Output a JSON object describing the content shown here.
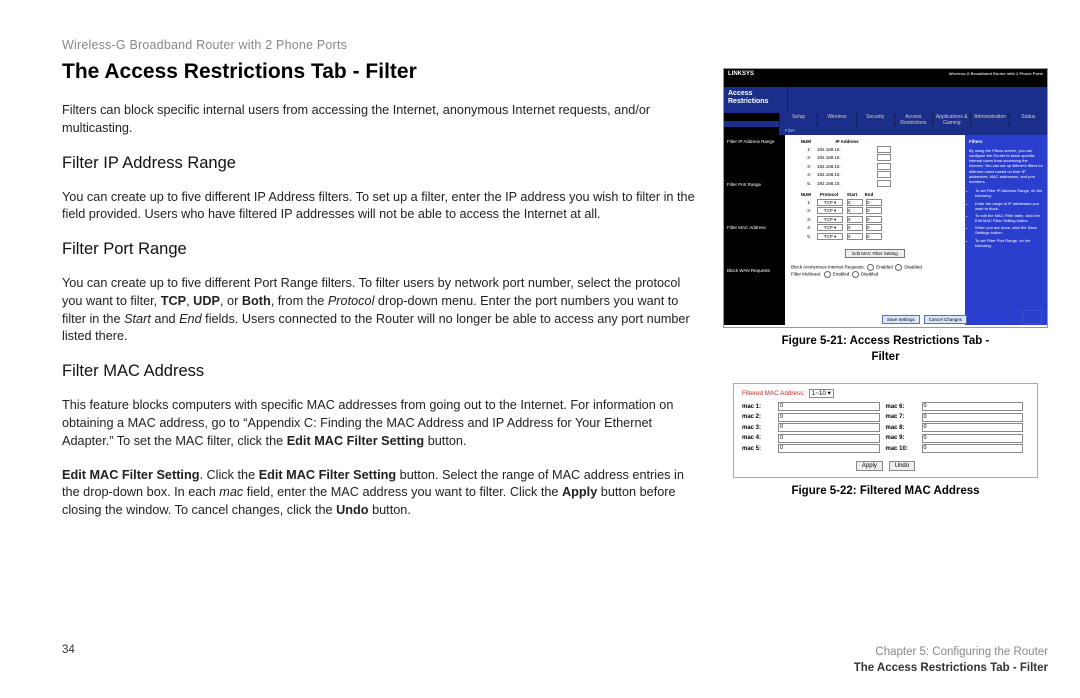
{
  "product_line": "Wireless-G Broadband Router with 2 Phone Ports",
  "heading": "The Access Restrictions Tab - Filter",
  "intro": "Filters can block specific internal users from accessing the Internet, anonymous Internet requests, and/or multicasting.",
  "sections": {
    "ip": {
      "title": "Filter IP Address Range",
      "body": "You can create up to five different IP Address filters. To set up a filter, enter the IP address you wish to filter in the field provided. Users who have filtered IP addresses will not be able to access the Internet at all."
    },
    "port": {
      "title": "Filter Port Range",
      "body_html": "You can create up to five different Port Range filters. To filter users by network port number, select the protocol you want to filter, <b>TCP</b>, <b>UDP</b>, or <b>Both</b>, from the <i>Protocol</i> drop-down menu. Enter the port numbers you want to filter in the <i>Start</i> and <i>End</i> fields. Users connected to the Router will no longer be able to access any port number listed there."
    },
    "mac": {
      "title": "Filter MAC Address",
      "body1_html": "This feature blocks computers with specific MAC addresses from going out to the Internet. For information on obtaining a MAC address, go to “Appendix C: Finding the MAC Address and IP Address for Your Ethernet Adapter.” To set the MAC filter, click the <b>Edit MAC Filter Setting</b> button.",
      "body2_html": "<b>Edit MAC Filter Setting</b>. Click the <b>Edit MAC Filter Setting</b> button. Select the range of MAC address entries in the drop-down box. In each <i>mac</i> field, enter the MAC address you want to filter.  Click the <b>Apply</b> button before closing the window. To cancel changes, click the <b>Undo</b> button."
    }
  },
  "fig1": {
    "caption": "Figure 5-21: Access Restrictions Tab - Filter",
    "brand": "LINKSYS",
    "device": "Wireless-G Broadband Router with 2 Phone Ports",
    "section": "Access Restrictions",
    "tabs": [
      "Setup",
      "Wireless",
      "Security",
      "Access Restrictions",
      "Applications & Gaming",
      "Administration",
      "Status"
    ],
    "subtabs": [
      "Filter"
    ],
    "left_labels": [
      "Filter IP Address Range",
      "Filter Port Range",
      "Filter MAC Address",
      "Block WAN Requests"
    ],
    "mid": {
      "ip_header_num": "NUM",
      "ip_header_addr": "IP Address",
      "ip_rows": [
        {
          "n": "1:",
          "ip": "192.168.15."
        },
        {
          "n": "2:",
          "ip": "192.168.15."
        },
        {
          "n": "3:",
          "ip": "192.168.15."
        },
        {
          "n": "4:",
          "ip": "192.168.15."
        },
        {
          "n": "5:",
          "ip": "192.168.15."
        }
      ],
      "port_headers": [
        "NUM",
        "Protocol",
        "Start",
        "End"
      ],
      "port_rows": [
        {
          "n": "1:",
          "proto": "TCP",
          "start": "0",
          "end": "0"
        },
        {
          "n": "2:",
          "proto": "TCP",
          "start": "0",
          "end": "0"
        },
        {
          "n": "3:",
          "proto": "TCP",
          "start": "0",
          "end": "0"
        },
        {
          "n": "4:",
          "proto": "TCP",
          "start": "0",
          "end": "0"
        },
        {
          "n": "5:",
          "proto": "TCP",
          "start": "0",
          "end": "0"
        }
      ],
      "mac_button": "Edit MAC Filter Setting",
      "wan_label": "Block Anonymous Internet Requests:",
      "wan_enabled": "Enabled",
      "wan_disabled": "Disabled",
      "multicast_label": "Filter Multicast:",
      "save": "Save Settings",
      "cancel": "Cancel Changes"
    },
    "help": {
      "title": "Filters",
      "intro": "By using the Filters screen, you can configure the Router to block specific internal users from accessing the Internet. You can set up different filters for different users based on their IP addresses, MAC addresses, and port numbers.",
      "items": [
        "To set Filter IP Address Range, do the following:",
        "Enter the range of IP addresses you want to block.",
        "To edit the MAC Filter table, click the Edit MAC Filter Setting button.",
        "When you are done, click the Save Settings button.",
        "To set Filter Port Range, do the following:"
      ]
    }
  },
  "fig2": {
    "caption": "Figure 5-22: Filtered MAC Address",
    "top_label": "Filtered MAC Address:",
    "range": "1~10",
    "mac_labels": [
      "mac 1:",
      "mac 2:",
      "mac 3:",
      "mac 4:",
      "mac 5:",
      "mac 6:",
      "mac 7:",
      "mac 8:",
      "mac 9:",
      "mac 10:"
    ],
    "mac_placeholder": "0",
    "apply": "Apply",
    "undo": "Undo"
  },
  "footer": {
    "page_no": "34",
    "chapter": "Chapter 5: Configuring the Router",
    "section": "The Access Restrictions Tab - Filter"
  }
}
